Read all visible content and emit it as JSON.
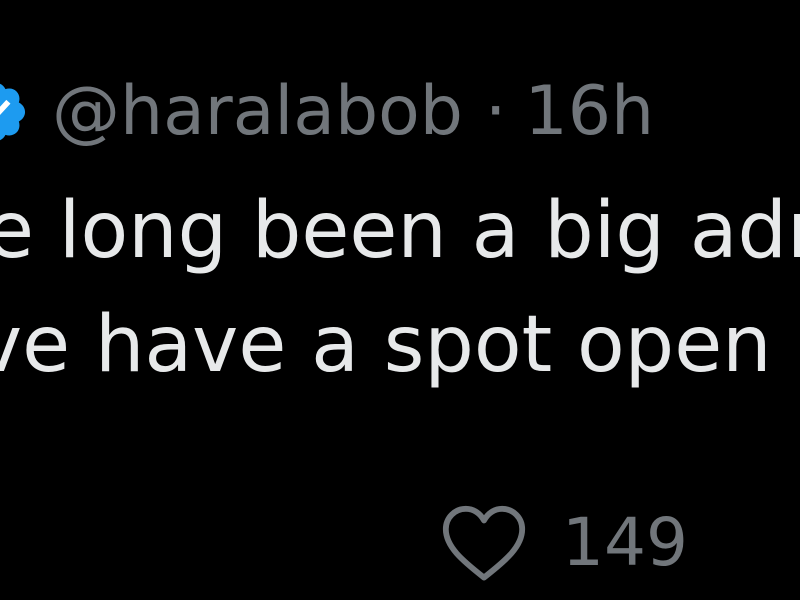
{
  "post": {
    "handle": "@haralabob",
    "separator": "·",
    "time": "16h",
    "text_lines": [
      "e long been a big adr",
      "ve have a spot open a"
    ],
    "likes": "149"
  },
  "icons": {
    "badge": "verified-badge-icon",
    "like": "heart-icon"
  },
  "colors": {
    "background": "#000000",
    "text": "#e7e9ea",
    "muted": "#71767b",
    "verified": "#1d9bf0"
  }
}
